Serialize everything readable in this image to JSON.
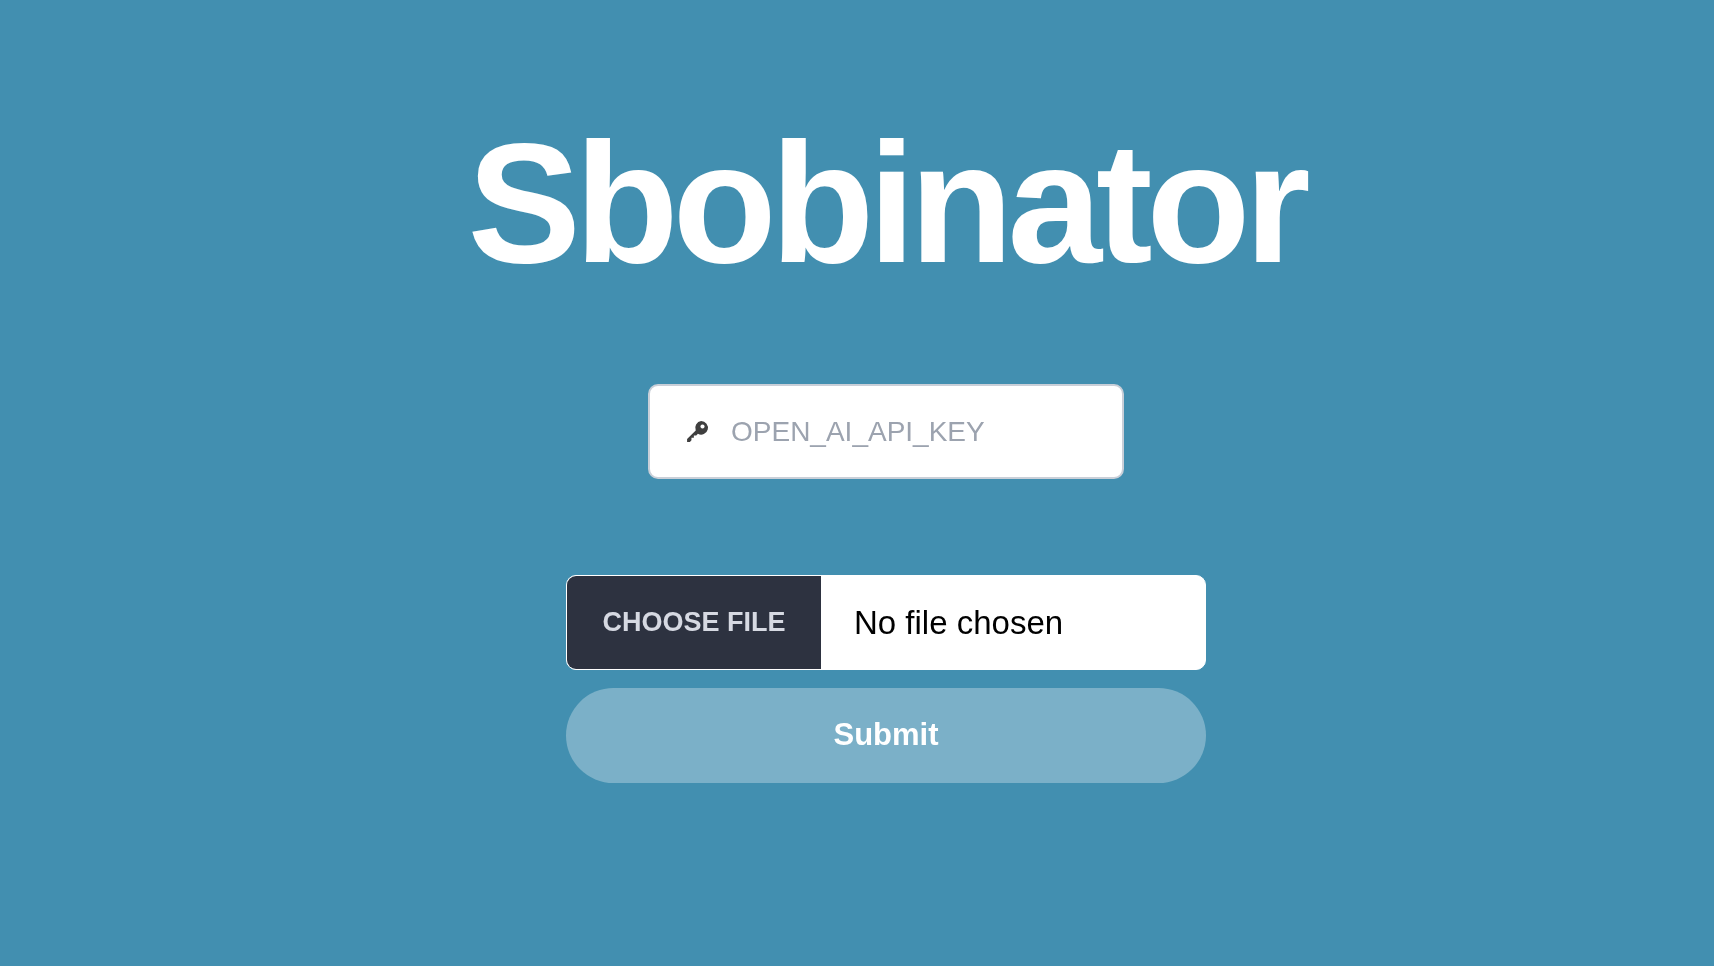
{
  "title": "Sbobinator",
  "api_key_field": {
    "placeholder": "OPEN_AI_API_KEY"
  },
  "file_input": {
    "button": "CHOOSE FILE",
    "status": "No file chosen"
  },
  "submit_button": {
    "label": "Submit",
    "disabled": true
  }
}
